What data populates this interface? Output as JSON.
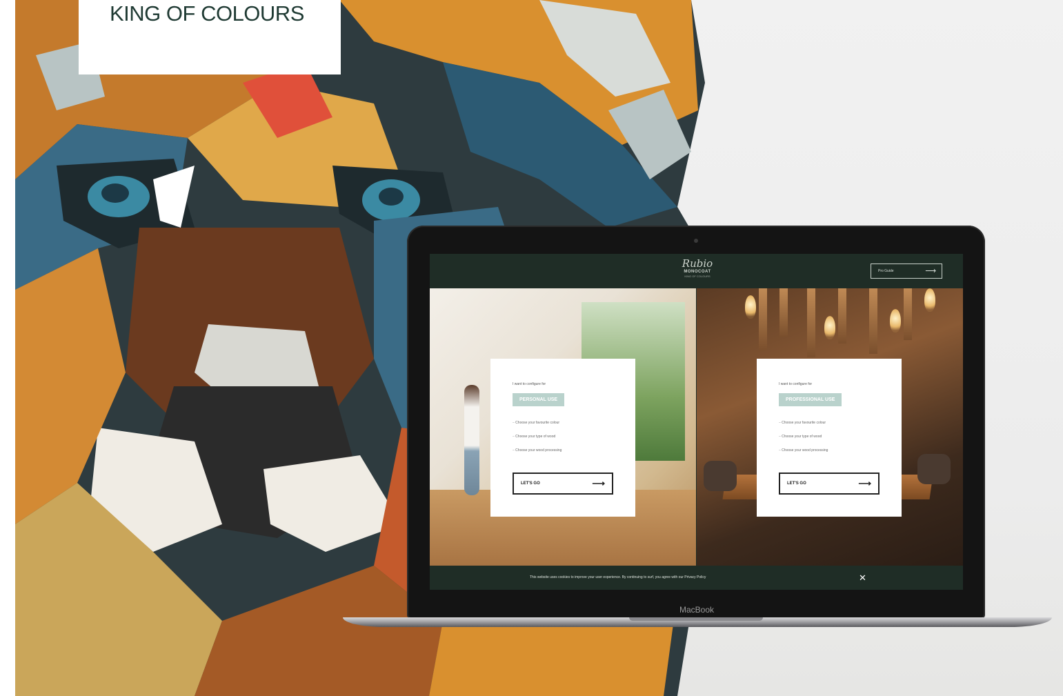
{
  "banner": {
    "title": "KING OF COLOURS"
  },
  "laptop": {
    "model_label": "MacBook"
  },
  "site": {
    "logo": {
      "script": "Rubio",
      "brand": "MONOCOAT",
      "tagline": "KING OF COLOURS"
    },
    "header_button": {
      "label": "Pro Guide",
      "icon": "arrow-right-icon"
    },
    "cards": [
      {
        "pre": "I want to configure for",
        "pill": "PERSONAL USE",
        "items": [
          "Choose your favourite colour",
          "Choose your type of wood",
          "Choose your wood processing"
        ],
        "button": "LET'S GO"
      },
      {
        "pre": "I want to configure for",
        "pill": "PROFESSIONAL USE",
        "items": [
          "Choose your favourite colour",
          "Choose your type of wood",
          "Choose your wood processing"
        ],
        "button": "LET'S GO"
      }
    ],
    "cookie_banner": {
      "text": "This website uses cookies to improve your user experience. By continuing to surf, you agree with our Privacy Policy",
      "close": "✕"
    }
  },
  "colors": {
    "brand_green": "#1f2d26",
    "pill_teal": "#b9d2cc",
    "title_green": "#1f3a33"
  }
}
